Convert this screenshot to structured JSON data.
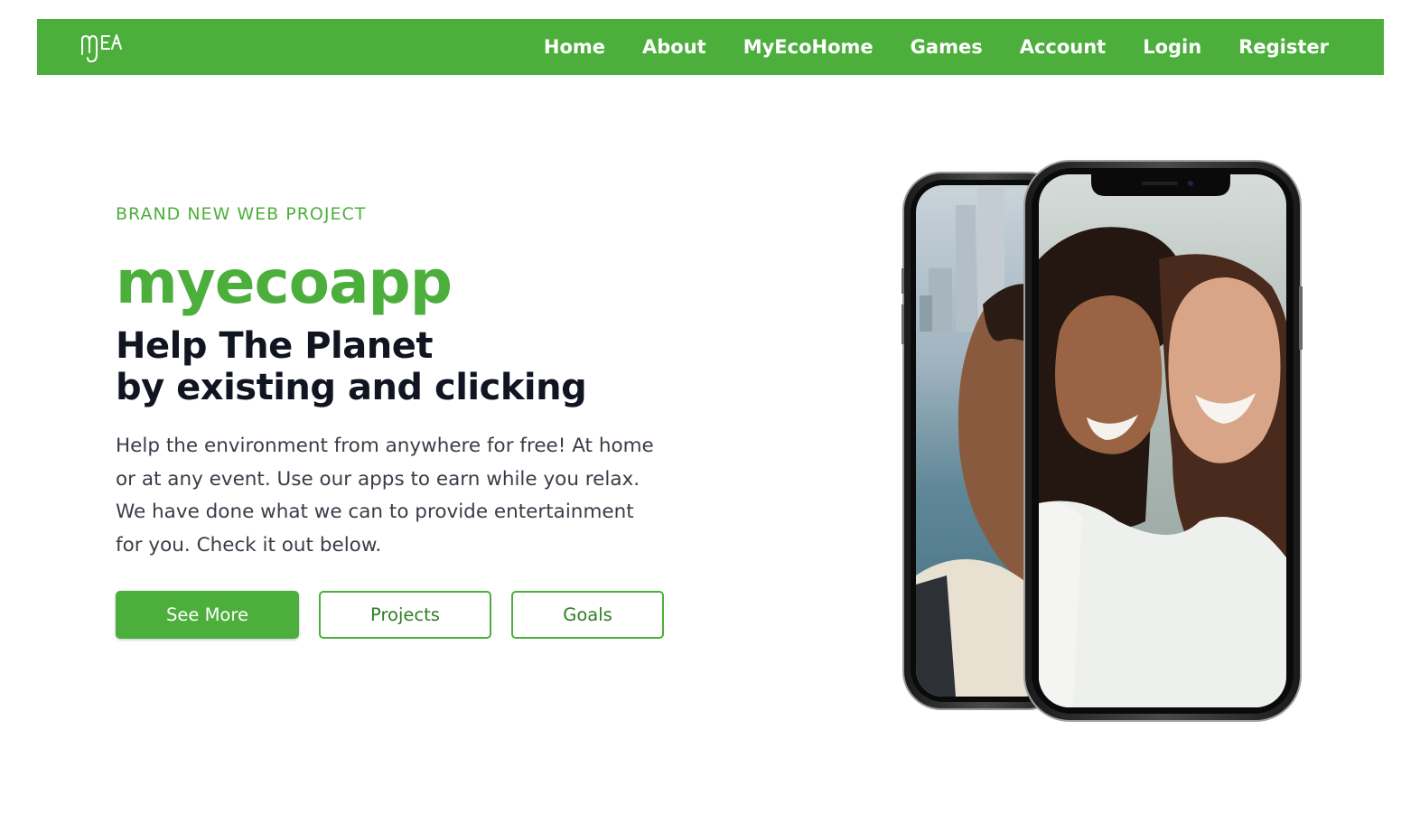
{
  "nav": {
    "logo_text": "mEA",
    "links": [
      "Home",
      "About",
      "MyEcoHome",
      "Games",
      "Account",
      "Login",
      "Register"
    ]
  },
  "hero": {
    "eyebrow": "BRAND NEW WEB PROJECT",
    "brand": "myecoapp",
    "headline_line1": "Help The Planet",
    "headline_line2": "by existing and clicking",
    "description": "Help the environment from anywhere for free! At home or at any event. Use our apps to earn while you relax. We have done what we can to provide entertainment for you. Check it out below.",
    "buttons": {
      "primary": "See More",
      "secondary": "Projects",
      "tertiary": "Goals"
    }
  },
  "colors": {
    "brand_green": "#4caf3c",
    "dark_text": "#111522"
  }
}
